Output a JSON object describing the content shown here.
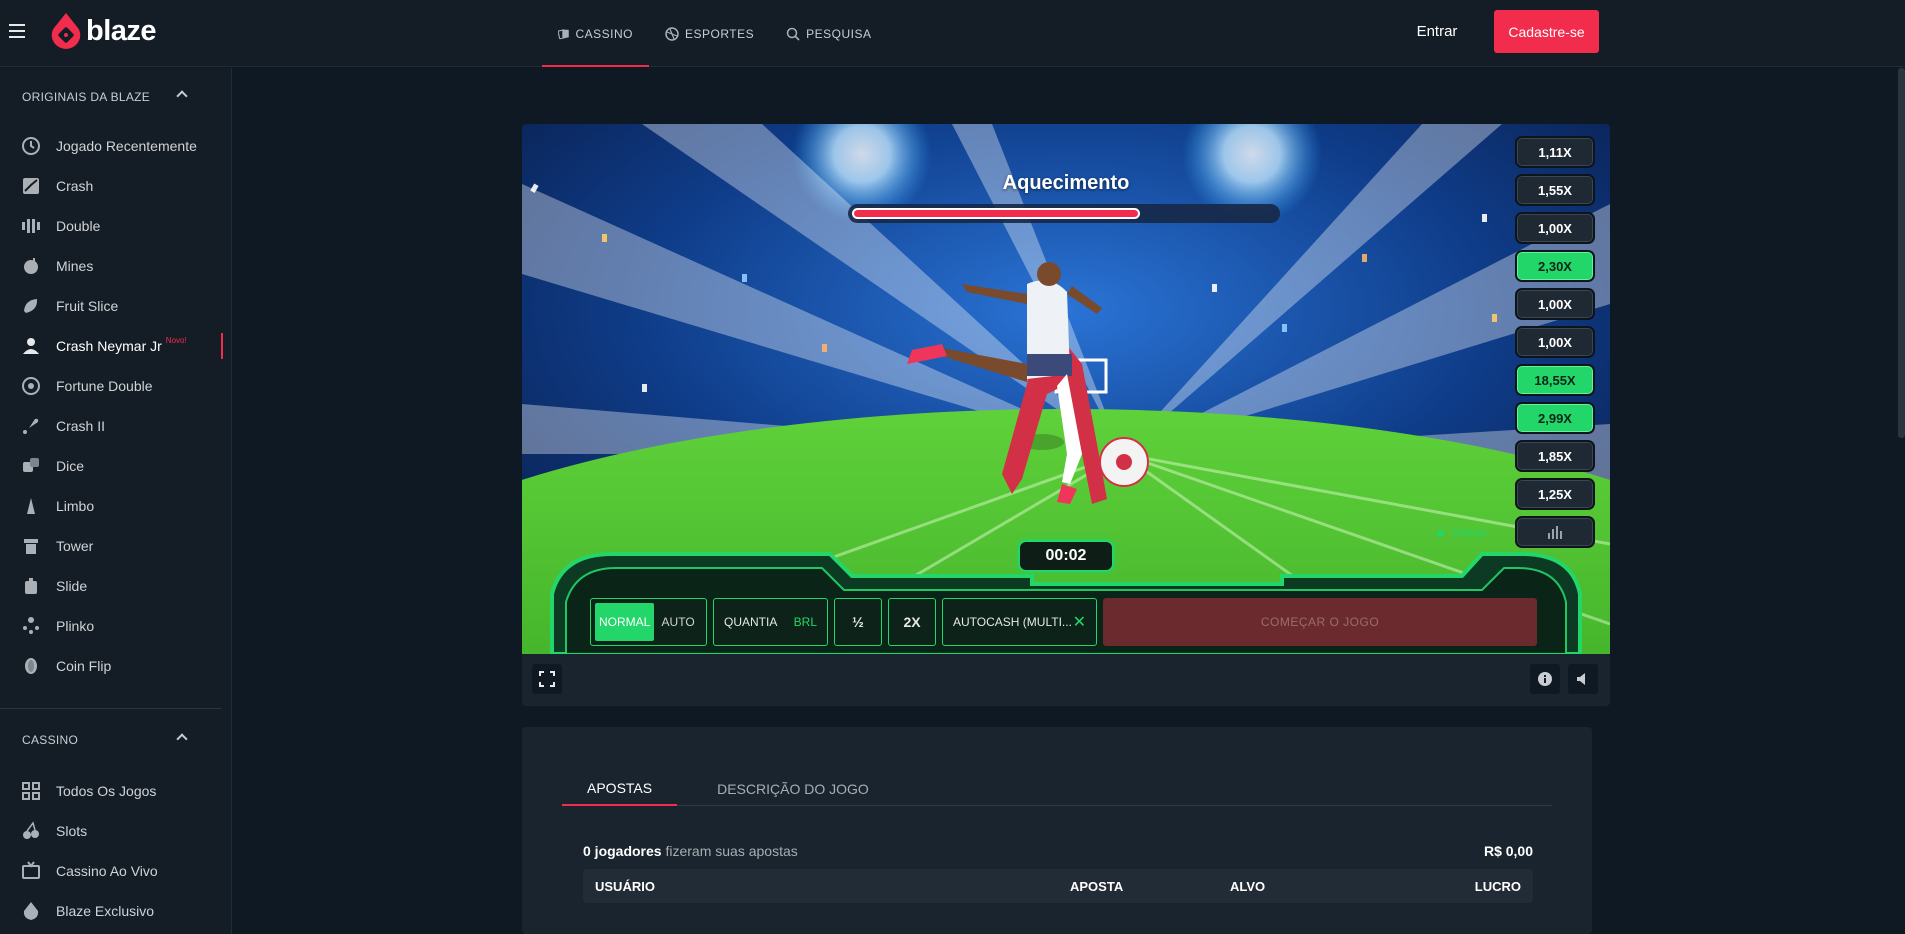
{
  "header": {
    "brand": "blaze",
    "nav": [
      {
        "label": "CASSINO",
        "icon": "casino-icon",
        "active": true
      },
      {
        "label": "ESPORTES",
        "icon": "sports-icon",
        "active": false
      },
      {
        "label": "PESQUISA",
        "icon": "search-icon",
        "active": false
      }
    ],
    "login_label": "Entrar",
    "signup_label": "Cadastre-se",
    "accent": "#f12c4c"
  },
  "sidebar": {
    "originals_title": "ORIGINAIS DA BLAZE",
    "originals": [
      {
        "label": "Jogado Recentemente",
        "icon": "clock-icon"
      },
      {
        "label": "Crash",
        "icon": "crash-icon"
      },
      {
        "label": "Double",
        "icon": "double-icon"
      },
      {
        "label": "Mines",
        "icon": "mines-icon"
      },
      {
        "label": "Fruit Slice",
        "icon": "fruit-icon"
      },
      {
        "label": "Crash Neymar Jr",
        "icon": "neymar-icon",
        "badge": "Novo!",
        "active": true
      },
      {
        "label": "Fortune Double",
        "icon": "fortune-icon"
      },
      {
        "label": "Crash II",
        "icon": "rocket-icon"
      },
      {
        "label": "Dice",
        "icon": "dice-icon"
      },
      {
        "label": "Limbo",
        "icon": "limbo-icon"
      },
      {
        "label": "Tower",
        "icon": "tower-icon"
      },
      {
        "label": "Slide",
        "icon": "slide-icon"
      },
      {
        "label": "Plinko",
        "icon": "plinko-icon"
      },
      {
        "label": "Coin Flip",
        "icon": "coin-icon"
      }
    ],
    "casino_title": "CASSINO",
    "casino": [
      {
        "label": "Todos Os Jogos",
        "icon": "grid-icon"
      },
      {
        "label": "Slots",
        "icon": "cherry-icon"
      },
      {
        "label": "Cassino Ao Vivo",
        "icon": "tv-icon"
      },
      {
        "label": "Blaze Exclusivo",
        "icon": "blaze-icon"
      }
    ]
  },
  "game": {
    "status_title": "Aquecimento",
    "progress": 0.68,
    "history": [
      {
        "value": "1,11X",
        "green": false
      },
      {
        "value": "1,55X",
        "green": false
      },
      {
        "value": "1,00X",
        "green": false
      },
      {
        "value": "2,30X",
        "green": true
      },
      {
        "value": "1,00X",
        "green": false
      },
      {
        "value": "1,00X",
        "green": false
      },
      {
        "value": "18,55X",
        "green": true
      },
      {
        "value": "2,99X",
        "green": true
      },
      {
        "value": "1,85X",
        "green": false
      },
      {
        "value": "1,25X",
        "green": false
      }
    ],
    "online_label": "Online",
    "timer": "00:02",
    "controls": {
      "mode_normal": "NORMAL",
      "mode_auto": "AUTO",
      "quantity_label": "QUANTIA",
      "currency": "BRL",
      "half": "½",
      "double": "2X",
      "autocash": "AUTOCASH (MULTI...",
      "start": "COMEÇAR O JOGO"
    },
    "green": "#22d66a"
  },
  "bets": {
    "tabs": [
      {
        "label": "APOSTAS",
        "active": true
      },
      {
        "label": "DESCRIÇÃO DO JOGO",
        "active": false
      }
    ],
    "players_count": "0 jogadores",
    "players_text": "fizeram suas apostas",
    "total": "R$ 0,00",
    "columns": {
      "user": "USUÁRIO",
      "bet": "APOSTA",
      "target": "ALVO",
      "profit": "LUCRO"
    }
  }
}
